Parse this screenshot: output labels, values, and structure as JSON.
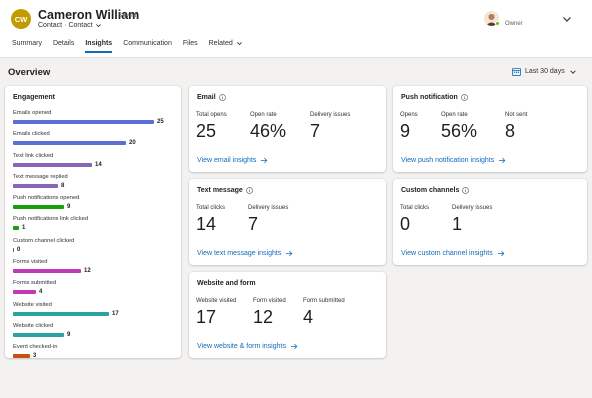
{
  "header": {
    "avatar_initials": "CW",
    "avatar_color": "#c19c00",
    "name": "Cameron William",
    "saved": "Saved",
    "entity": "Contact",
    "form": "Contact",
    "owner_label": "Owner"
  },
  "tabs": [
    {
      "label": "Summary",
      "active": false
    },
    {
      "label": "Details",
      "active": false
    },
    {
      "label": "Insights",
      "active": true
    },
    {
      "label": "Communication",
      "active": false
    },
    {
      "label": "Files",
      "active": false
    },
    {
      "label": "Related",
      "active": false
    }
  ],
  "overview": {
    "title": "Overview",
    "date_range": "Last 30 days"
  },
  "engagement": {
    "title": "Engagement",
    "max_value": 25,
    "items": [
      {
        "label": "Emails opened",
        "value": 25,
        "color": "#5b6fd6"
      },
      {
        "label": "Emails clicked",
        "value": 20,
        "color": "#5b6fd6"
      },
      {
        "label": "Text link clicked",
        "value": 14,
        "color": "#8764b8"
      },
      {
        "label": "Text message replied",
        "value": 8,
        "color": "#8764b8"
      },
      {
        "label": "Push notifications opened",
        "value": 9,
        "color": "#13a10e"
      },
      {
        "label": "Push notifications link clicked",
        "value": 1,
        "color": "#13a10e"
      },
      {
        "label": "Custom channel clicked",
        "value": 0,
        "color": "#605e5c"
      },
      {
        "label": "Forms visited",
        "value": 12,
        "color": "#c239b3"
      },
      {
        "label": "Forms submitted",
        "value": 4,
        "color": "#c239b3"
      },
      {
        "label": "Website visited",
        "value": 17,
        "color": "#2ba3a3"
      },
      {
        "label": "Website clicked",
        "value": 9,
        "color": "#2ba3a3"
      },
      {
        "label": "Event checked-in",
        "value": 3,
        "color": "#ca5010"
      }
    ]
  },
  "email": {
    "title": "Email",
    "metrics": [
      {
        "label": "Total opens",
        "value": "25"
      },
      {
        "label": "Open rate",
        "value": "46%"
      },
      {
        "label": "Delivery issues",
        "value": "7"
      }
    ],
    "link": "View email insights"
  },
  "push": {
    "title": "Push notification",
    "metrics": [
      {
        "label": "Opens",
        "value": "9"
      },
      {
        "label": "Open rate",
        "value": "56%"
      },
      {
        "label": "Not sent",
        "value": "8"
      }
    ],
    "link": "View push notification insights"
  },
  "text": {
    "title": "Text message",
    "metrics": [
      {
        "label": "Total clicks",
        "value": "14"
      },
      {
        "label": "Delivery issues",
        "value": "7"
      }
    ],
    "link": "View text message insights"
  },
  "custom": {
    "title": "Custom channels",
    "metrics": [
      {
        "label": "Total clicks",
        "value": "0"
      },
      {
        "label": "Delivery issues",
        "value": "1"
      }
    ],
    "link": "View custom channel insights"
  },
  "website": {
    "title": "Website and form",
    "metrics": [
      {
        "label": "Website visited",
        "value": "17"
      },
      {
        "label": "Form visited",
        "value": "12"
      },
      {
        "label": "Form submitted",
        "value": "4"
      }
    ],
    "link": "View website & form insights"
  },
  "icons": {
    "chevron": "chevron-down-icon",
    "calendar": "calendar-icon",
    "info": "info-icon",
    "arrow": "arrow-right-icon"
  }
}
